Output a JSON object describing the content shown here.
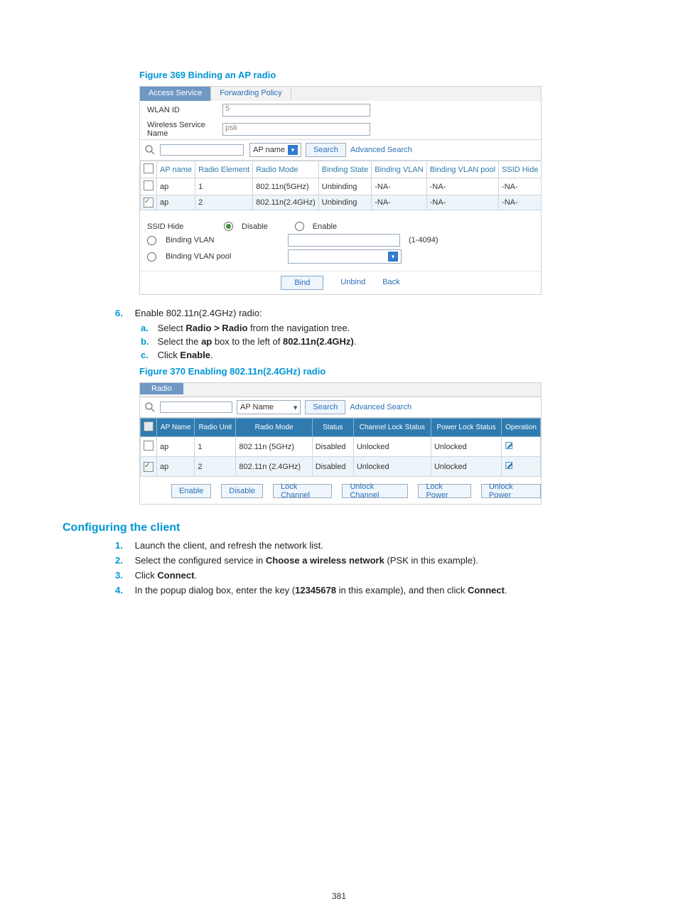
{
  "figure369": {
    "caption": "Figure 369 Binding an AP radio",
    "tabs": {
      "active": "Access Service",
      "other": "Forwarding Policy"
    },
    "wlan_id_label": "WLAN ID",
    "wlan_id_value": "5",
    "service_name_label": "Wireless Service Name",
    "service_name_value": "psk",
    "filter_field": "AP name",
    "search_btn": "Search",
    "adv_search": "Advanced Search",
    "cols": [
      "AP name",
      "Radio Element",
      "Radio Mode",
      "Binding State",
      "Binding VLAN",
      "Binding VLAN pool",
      "SSID Hide"
    ],
    "rows": [
      {
        "checked": false,
        "cells": [
          "ap",
          "1",
          "802.11n(5GHz)",
          "Unbinding",
          "-NA-",
          "-NA-",
          "-NA-"
        ]
      },
      {
        "checked": true,
        "cells": [
          "ap",
          "2",
          "802.11n(2.4GHz)",
          "Unbinding",
          "-NA-",
          "-NA-",
          "-NA-"
        ]
      }
    ],
    "ssid_hide_label": "SSID Hide",
    "ssid_disable": "Disable",
    "ssid_enable": "Enable",
    "binding_vlan": "Binding VLAN",
    "binding_vlan_range": "(1-4094)",
    "binding_vlan_pool": "Binding VLAN pool",
    "btn_bind": "Bind",
    "btn_unbind": "Unbind",
    "btn_back": "Back"
  },
  "step6": {
    "num": "6.",
    "text": "Enable 802.11n(2.4GHz) radio:",
    "a_pref": "a.",
    "a_t1": "Select ",
    "a_b": "Radio > Radio",
    "a_t2": " from the navigation tree.",
    "b_pref": "b.",
    "b_t1": "Select the ",
    "b_b1": "ap",
    "b_t2": " box to the left of ",
    "b_b2": "802.11n(2.4GHz)",
    "b_t3": ".",
    "c_pref": "c.",
    "c_t1": "Click ",
    "c_b": "Enable",
    "c_t2": "."
  },
  "figure370": {
    "caption": "Figure 370 Enabling 802.11n(2.4GHz) radio",
    "tab": "Radio",
    "filter_field": "AP Name",
    "search_btn": "Search",
    "adv_search": "Advanced Search",
    "cols": [
      "",
      "AP Name",
      "Radio Unit",
      "Radio Mode",
      "Status",
      "Channel Lock Status",
      "Power Lock Status",
      "Operation"
    ],
    "rows": [
      {
        "checked": false,
        "cells": [
          "ap",
          "1",
          "802.11n (5GHz)",
          "Disabled",
          "Unlocked",
          "Unlocked"
        ]
      },
      {
        "checked": true,
        "cells": [
          "ap",
          "2",
          "802.11n (2.4GHz)",
          "Disabled",
          "Unlocked",
          "Unlocked"
        ]
      }
    ],
    "btns": [
      "Enable",
      "Disable",
      "Lock Channel",
      "Unlock Channel",
      "Lock Power",
      "Unlock Power"
    ]
  },
  "client": {
    "heading": "Configuring the client",
    "s1n": "1.",
    "s1": "Launch the client, and refresh the network list.",
    "s2n": "2.",
    "s2_a": "Select the configured service in ",
    "s2_b": "Choose a wireless network",
    "s2_c": " (PSK in this example).",
    "s3n": "3.",
    "s3_a": "Click ",
    "s3_b": "Connect",
    "s3_c": ".",
    "s4n": "4.",
    "s4_a": "In the popup dialog box, enter the key (",
    "s4_b": "12345678",
    "s4_c": " in this example), and then click ",
    "s4_d": "Connect",
    "s4_e": "."
  },
  "page_number": "381"
}
